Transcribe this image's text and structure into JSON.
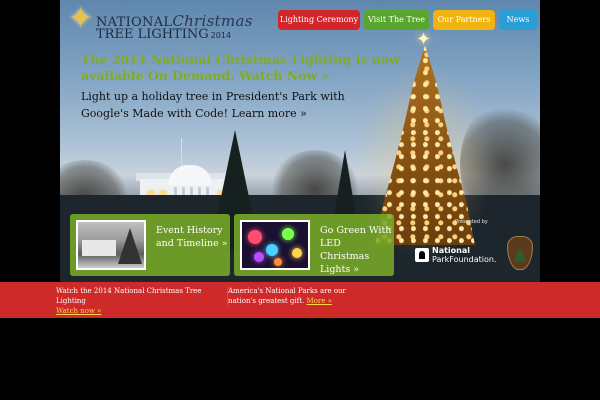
{
  "logo": {
    "line1_a": "NATIONAL",
    "line1_b": "Christmas",
    "line2": "TREE LIGHTING",
    "year": "2014"
  },
  "nav": [
    {
      "label": "Lighting Ceremony",
      "color": "#d3262b"
    },
    {
      "label": "Visit The Tree",
      "color": "#58a52f"
    },
    {
      "label": "Our Partners",
      "color": "#f1b40f"
    },
    {
      "label": "News",
      "color": "#2a9fd6"
    }
  ],
  "hero": {
    "headline": "The 2014 National Christmas Lighting is now available On Demand. Watch Now »",
    "subline": "Light up a holiday tree in President's Park with Google's Made with Code! Learn more »"
  },
  "features": [
    {
      "label": "Event History and Timeline »"
    },
    {
      "label": "Go Green With LED Christmas Lights »"
    }
  ],
  "presented": {
    "label": "Presented by",
    "npf_line1": "National",
    "npf_line2": "ParkFoundation."
  },
  "footer": {
    "item1_text": "Watch the 2014 National Christmas Tree Lighting",
    "item1_link": "Watch now »",
    "item2_text": "America's National Parks are our nation's greatest gift.",
    "item2_link": "More »"
  },
  "colors": {
    "accent_green": "#7fad1f",
    "footer_red": "#cf2a2a",
    "link_yellow": "#ffd34a"
  }
}
